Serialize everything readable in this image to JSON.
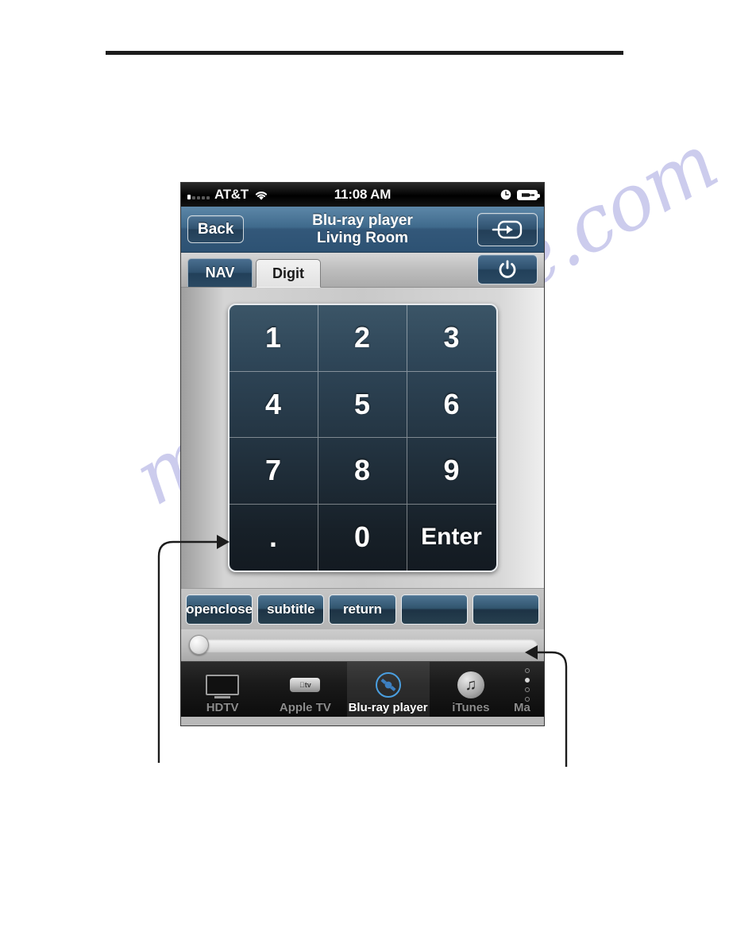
{
  "statusbar": {
    "carrier": "AT&T",
    "clock": "11:08 AM",
    "signal_bars_total": 5,
    "signal_bars_filled": 1,
    "wifi_icon": "wifi-icon",
    "alarm_icon": "alarm-clock-icon",
    "battery_icon": "battery-charging-icon"
  },
  "navbar": {
    "back_label": "Back",
    "title_line1": "Blu-ray player",
    "title_line2": "Living Room",
    "input_icon": "input-source-icon"
  },
  "tabstrip": {
    "tabs": [
      {
        "label": "NAV",
        "active": false
      },
      {
        "label": "Digit",
        "active": true
      }
    ],
    "power_icon": "power-icon"
  },
  "keypad": {
    "keys": [
      "1",
      "2",
      "3",
      "4",
      "5",
      "6",
      "7",
      "8",
      "9",
      ".",
      "0",
      "Enter"
    ]
  },
  "macro_row": {
    "buttons": [
      "openclose",
      "subtitle",
      "return",
      "",
      ""
    ]
  },
  "slider": {
    "name": "page-scroll-slider",
    "thumb_position_percent": 0
  },
  "tabbar": {
    "devices": [
      {
        "label": "HDTV",
        "icon": "television-icon",
        "selected": false
      },
      {
        "label": "Apple TV",
        "icon": "apple-tv-icon",
        "selected": false
      },
      {
        "label": "Blu-ray player",
        "icon": "blu-ray-disc-icon",
        "selected": true
      },
      {
        "label": "iTunes",
        "icon": "itunes-note-icon",
        "selected": false
      },
      {
        "label": "Ma",
        "icon": "clipped-device-icon",
        "selected": false
      }
    ],
    "page_dots_total": 4,
    "page_dots_active_index": 1
  },
  "watermark": {
    "text": "manualshive.com"
  },
  "callouts": [
    {
      "name": "keypad-callout",
      "direction": "right"
    },
    {
      "name": "slider-callout",
      "direction": "left"
    }
  ],
  "colors": {
    "nav_blue": "#33587a",
    "button_blue": "#2f516e",
    "keypad_dark": "#172028",
    "accent_white": "#ffffff",
    "tabbar_black": "#0c0c0c",
    "watermark": "#5656c4"
  }
}
